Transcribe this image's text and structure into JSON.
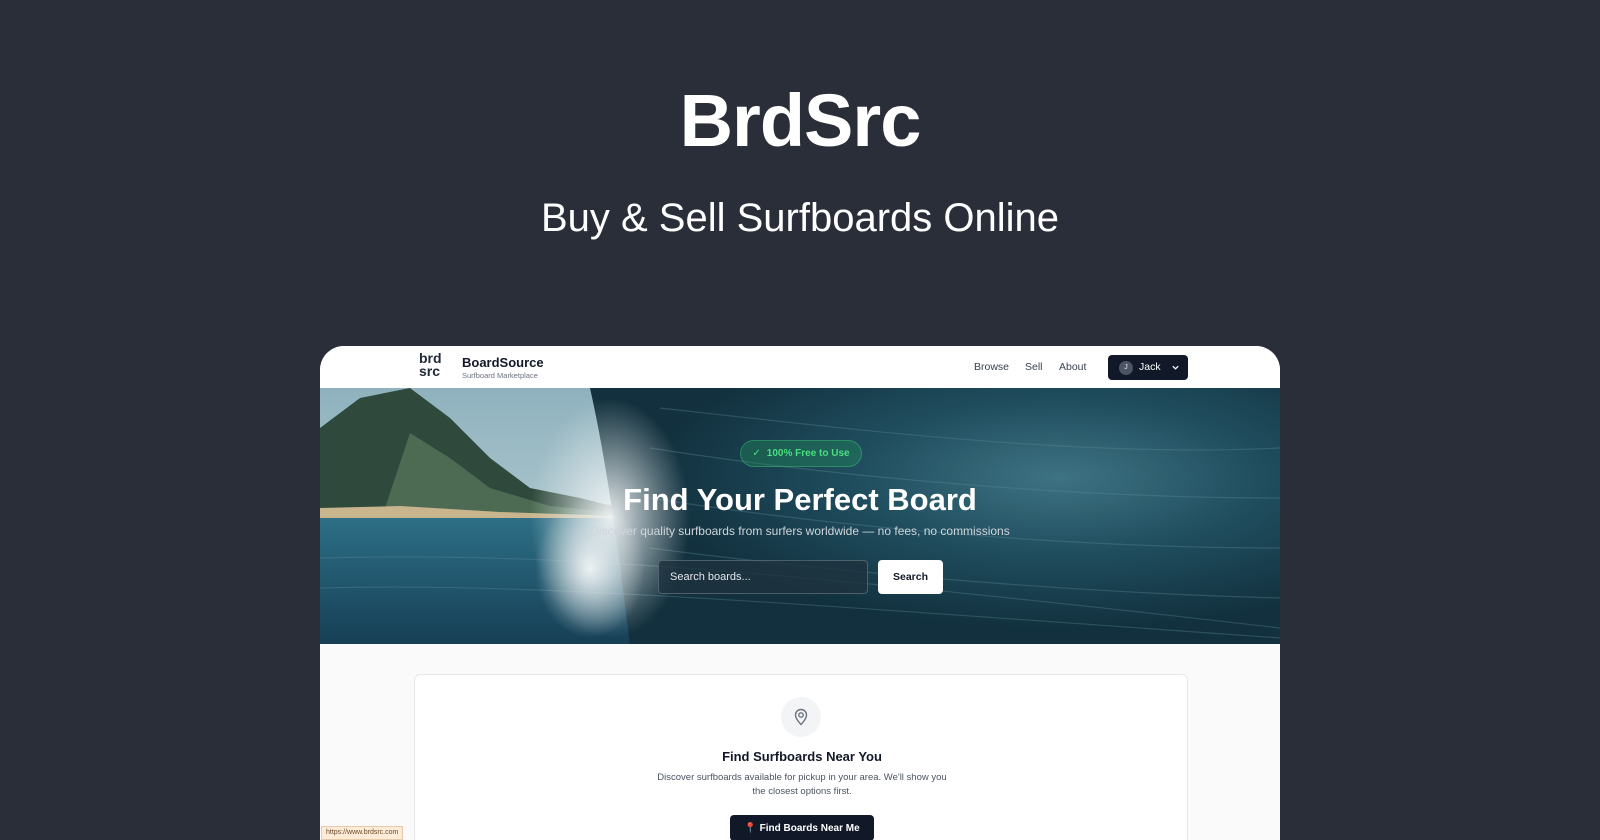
{
  "promo": {
    "title": "BrdSrc",
    "subtitle": "Buy & Sell Surfboards Online"
  },
  "header": {
    "logo_line1": "brd",
    "logo_line2": "src",
    "brand": "BoardSource",
    "tagline": "Surfboard Marketplace",
    "nav": [
      "Browse",
      "Sell",
      "About"
    ],
    "user": {
      "initial": "J",
      "name": "Jack"
    }
  },
  "hero": {
    "badge": "100% Free to Use",
    "title": "Find Your Perfect Board",
    "subtitle": "Discover quality surfboards from surfers worldwide — no fees, no commissions",
    "search_placeholder": "Search boards...",
    "search_button": "Search"
  },
  "near": {
    "title": "Find Surfboards Near You",
    "description": "Discover surfboards available for pickup in your area. We'll show you the closest options first.",
    "button": "📍 Find Boards Near Me"
  },
  "status_bar": {
    "url": "https://www.brdsrc.com"
  },
  "icons": {
    "check": "check-icon",
    "chevron": "chevron-down-icon",
    "pin": "map-pin-icon"
  },
  "colors": {
    "page_bg": "#2a2e39",
    "primary_dark": "#111827",
    "badge_green": "#4ade80"
  }
}
